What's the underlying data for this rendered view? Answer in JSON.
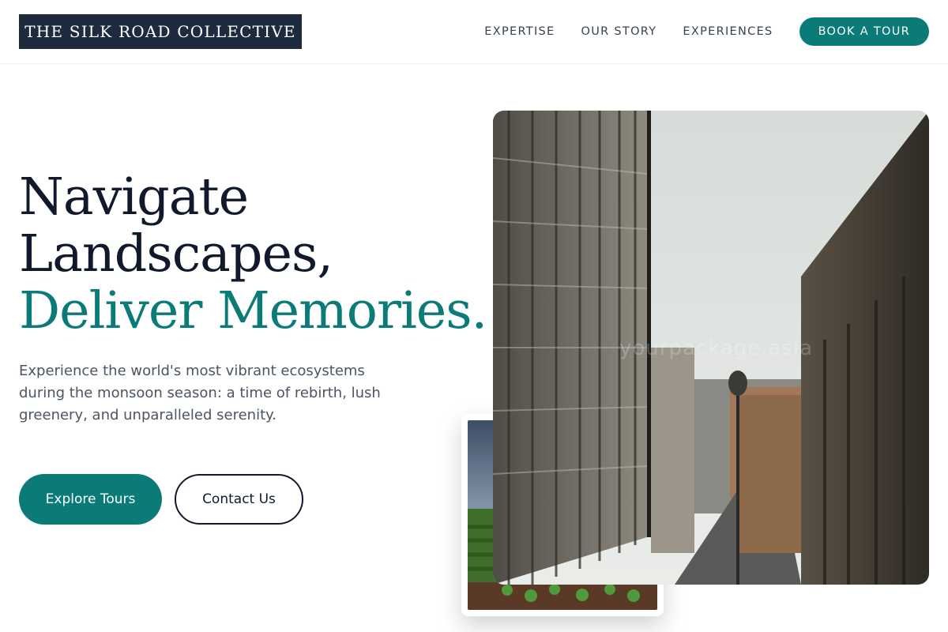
{
  "header": {
    "logo": "THE SILK ROAD COLLECTIVE",
    "nav": [
      "EXPERTISE",
      "OUR STORY",
      "EXPERIENCES"
    ],
    "cta": "BOOK A TOUR"
  },
  "hero": {
    "title_line1": "Navigate",
    "title_line2": "Landscapes,",
    "title_accent": "Deliver Memories.",
    "description": "Experience the world's most vibrant ecosystems during the monsoon season: a time of rebirth, lush greenery, and unparalleled serenity.",
    "primary_button": "Explore Tours",
    "secondary_button": "Contact Us"
  },
  "images": {
    "main_watermark": "yourpackage.asia",
    "main_photo": "city-street-photo",
    "secondary_photo": "green-field-photo"
  },
  "colors": {
    "accent": "#0b7b77",
    "navy": "#1e2a3d",
    "title": "#111a2c",
    "body_text": "#4b5563"
  }
}
